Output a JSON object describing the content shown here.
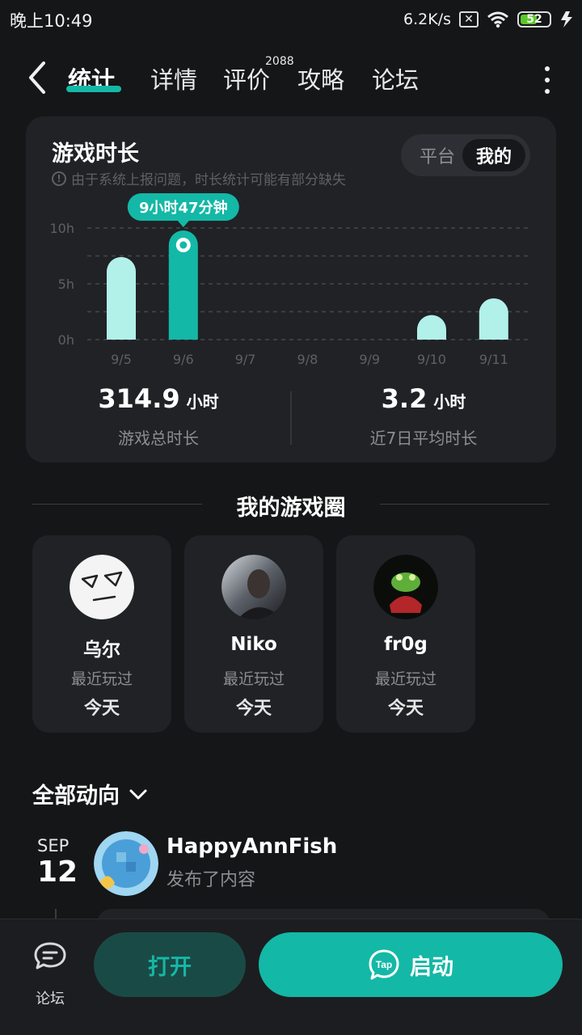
{
  "status_bar": {
    "time": "晚上10:49",
    "net_speed": "6.2K/s",
    "battery": "52"
  },
  "nav": {
    "tabs": [
      {
        "label": "统计",
        "active": true
      },
      {
        "label": "详情"
      },
      {
        "label": "评价",
        "badge": "2088"
      },
      {
        "label": "攻略"
      },
      {
        "label": "论坛"
      }
    ]
  },
  "stats_card": {
    "title": "游戏时长",
    "note": "由于系统上报问题，时长统计可能有部分缺失",
    "toggle": {
      "options": [
        "平台",
        "我的"
      ],
      "selected": "我的"
    },
    "tooltip": "9小时47分钟",
    "summary": [
      {
        "value": "314.9",
        "unit": "小时",
        "label": "游戏总时长"
      },
      {
        "value": "3.2",
        "unit": "小时",
        "label": "近7日平均时长"
      }
    ]
  },
  "chart_data": {
    "type": "bar",
    "categories": [
      "9/5",
      "9/6",
      "9/7",
      "9/8",
      "9/9",
      "9/10",
      "9/11"
    ],
    "values": [
      7.4,
      9.78,
      0,
      0,
      0,
      2.2,
      3.7
    ],
    "highlight_index": 1,
    "y_ticks": [
      "0h",
      "5h",
      "10h"
    ],
    "ylim": [
      0,
      10
    ],
    "grid": true,
    "colors": {
      "bar": "#b2f0ea",
      "highlight": "#14b8a6"
    }
  },
  "game_circle": {
    "title": "我的游戏圈",
    "friends": [
      {
        "name": "乌尔",
        "sub": "最近玩过",
        "when": "今天"
      },
      {
        "name": "Niko",
        "sub": "最近玩过",
        "when": "今天"
      },
      {
        "name": "fr0g",
        "sub": "最近玩过",
        "when": "今天"
      }
    ]
  },
  "feed": {
    "filter_label": "全部动向",
    "month": "SEP",
    "day": "12",
    "user": "HappyAnnFish",
    "action": "发布了内容"
  },
  "bottom_bar": {
    "forum_label": "论坛",
    "open_label": "打开",
    "launch_label": "启动",
    "tap_logo_text": "Tap"
  },
  "colors": {
    "accent": "#14b8a6",
    "background": "#151617",
    "card": "#202226"
  }
}
